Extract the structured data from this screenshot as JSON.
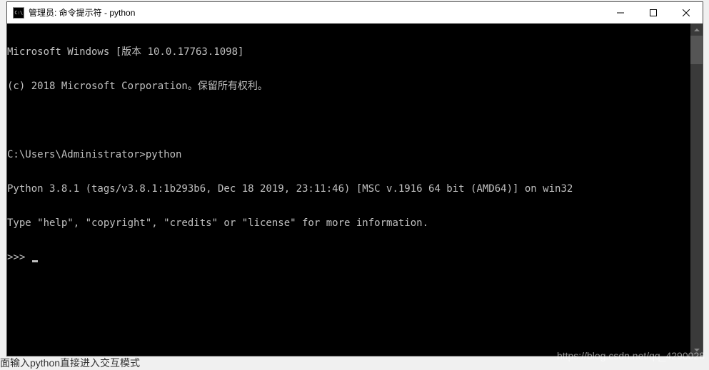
{
  "titlebar": {
    "icon_label": "C:\\",
    "title": "管理员: 命令提示符 - python"
  },
  "console": {
    "lines": [
      "Microsoft Windows [版本 10.0.17763.1098]",
      "(c) 2018 Microsoft Corporation。保留所有权利。",
      "",
      "C:\\Users\\Administrator>python",
      "Python 3.8.1 (tags/v3.8.1:1b293b6, Dec 18 2019, 23:11:46) [MSC v.1916 64 bit (AMD64)] on win32",
      "Type \"help\", \"copyright\", \"credits\" or \"license\" for more information."
    ],
    "prompt": ">>> "
  },
  "watermark": "https://blog.csdn.net/qq_4290028",
  "bg_text": "面输入python直接进入交互模式"
}
